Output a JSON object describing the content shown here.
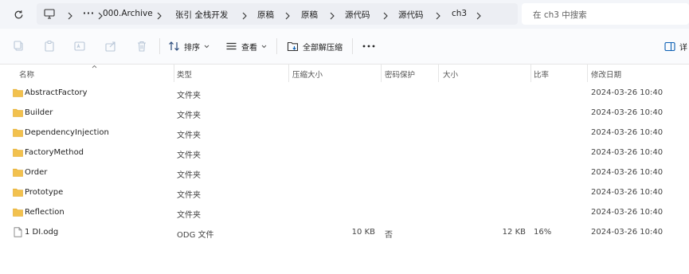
{
  "breadcrumb": [
    "000.Archive",
    "张引 全栈开发",
    "原稿",
    "原稿",
    "源代码",
    "源代码",
    "ch3"
  ],
  "search": {
    "placeholder": "在 ch3 中搜索"
  },
  "toolbar": {
    "sort_label": "排序",
    "view_label": "查看",
    "extract_all_label": "全部解压缩",
    "details_label": "详"
  },
  "columns": {
    "name": "名称",
    "type": "类型",
    "compressed_size": "压缩大小",
    "password": "密码保护",
    "size": "大小",
    "ratio": "比率",
    "modified": "修改日期"
  },
  "files": [
    {
      "name": "AbstractFactory",
      "type": "文件夹",
      "compressed_size": "",
      "password": "",
      "size": "",
      "ratio": "",
      "modified": "2024-03-26 10:40",
      "icon": "folder-icon"
    },
    {
      "name": "Builder",
      "type": "文件夹",
      "compressed_size": "",
      "password": "",
      "size": "",
      "ratio": "",
      "modified": "2024-03-26 10:40",
      "icon": "folder-icon"
    },
    {
      "name": "DependencyInjection",
      "type": "文件夹",
      "compressed_size": "",
      "password": "",
      "size": "",
      "ratio": "",
      "modified": "2024-03-26 10:40",
      "icon": "folder-icon"
    },
    {
      "name": "FactoryMethod",
      "type": "文件夹",
      "compressed_size": "",
      "password": "",
      "size": "",
      "ratio": "",
      "modified": "2024-03-26 10:40",
      "icon": "folder-icon"
    },
    {
      "name": "Order",
      "type": "文件夹",
      "compressed_size": "",
      "password": "",
      "size": "",
      "ratio": "",
      "modified": "2024-03-26 10:40",
      "icon": "folder-icon"
    },
    {
      "name": "Prototype",
      "type": "文件夹",
      "compressed_size": "",
      "password": "",
      "size": "",
      "ratio": "",
      "modified": "2024-03-26 10:40",
      "icon": "folder-icon"
    },
    {
      "name": "Reflection",
      "type": "文件夹",
      "compressed_size": "",
      "password": "",
      "size": "",
      "ratio": "",
      "modified": "2024-03-26 10:40",
      "icon": "folder-icon"
    },
    {
      "name": "1 DI.odg",
      "type": "ODG 文件",
      "compressed_size": "10 KB",
      "password": "否",
      "size": "12 KB",
      "ratio": "16%",
      "modified": "2024-03-26 10:40",
      "icon": "file-icon"
    }
  ],
  "colors": {
    "folder": "#f2c14e",
    "folder_dark": "#e0a92a",
    "accent": "#0a5fb4"
  }
}
